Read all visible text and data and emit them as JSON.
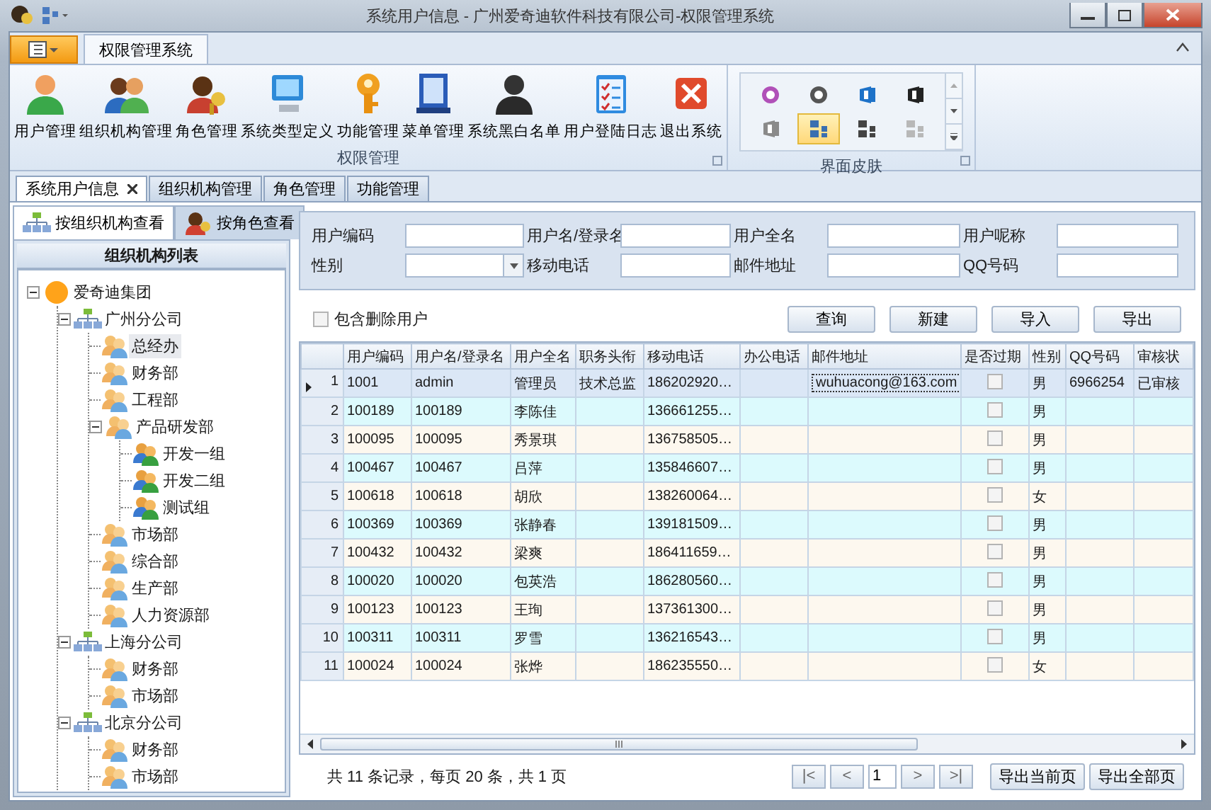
{
  "window": {
    "title": "系统用户信息 - 广州爱奇迪软件科技有限公司-权限管理系统"
  },
  "ribbon": {
    "tabs": [
      {
        "label": "权限管理系统",
        "selected": true
      }
    ],
    "groups": [
      {
        "label": "权限管理",
        "buttons": [
          {
            "label": "用户管理",
            "kind": "person"
          },
          {
            "label": "组织机构管理",
            "kind": "people"
          },
          {
            "label": "角色管理",
            "kind": "role"
          },
          {
            "label": "系统类型定义",
            "kind": "computer"
          },
          {
            "label": "功能管理",
            "kind": "key"
          },
          {
            "label": "菜单管理",
            "kind": "book"
          },
          {
            "label": "系统黑白名单",
            "kind": "silhouette"
          },
          {
            "label": "用户登陆日志",
            "kind": "checklist"
          },
          {
            "label": "退出系统",
            "kind": "exit"
          }
        ]
      }
    ],
    "skins": {
      "label": "界面皮肤",
      "items": [
        {
          "kind": "badge",
          "color": "#b050b8",
          "selected": false
        },
        {
          "kind": "badge",
          "color": "#555555",
          "selected": false
        },
        {
          "kind": "office",
          "color": "#1e72c8",
          "selected": false
        },
        {
          "kind": "office",
          "color": "#222222",
          "selected": false
        },
        {
          "kind": "office",
          "color": "#8a8a8a",
          "selected": false
        },
        {
          "kind": "tiles",
          "color": "#3a6fb0",
          "selected": true
        },
        {
          "kind": "tiles",
          "color": "#444444",
          "selected": false
        },
        {
          "kind": "tiles",
          "color": "#b8b8b8",
          "selected": false
        }
      ]
    }
  },
  "doc_tabs": [
    {
      "label": "系统用户信息",
      "selected": true,
      "closable": true
    },
    {
      "label": "组织机构管理",
      "selected": false,
      "closable": false
    },
    {
      "label": "角色管理",
      "selected": false,
      "closable": false
    },
    {
      "label": "功能管理",
      "selected": false,
      "closable": false
    }
  ],
  "left_panel": {
    "tabs": [
      {
        "label": "按组织机构查看",
        "kind": "org",
        "selected": true
      },
      {
        "label": "按角色查看",
        "kind": "role",
        "selected": false
      }
    ],
    "title": "组织机构列表",
    "tree": [
      {
        "label": "爱奇迪集团",
        "kind": "root",
        "expanded": true,
        "children": [
          {
            "label": "广州分公司",
            "kind": "branch",
            "expanded": true,
            "children": [
              {
                "label": "总经办",
                "kind": "dept",
                "selected": true
              },
              {
                "label": "财务部",
                "kind": "dept",
                "selected": false
              },
              {
                "label": "工程部",
                "kind": "dept",
                "selected": false
              },
              {
                "label": "产品研发部",
                "kind": "dept",
                "expanded": true,
                "selected": false,
                "children": [
                  {
                    "label": "开发一组",
                    "kind": "team",
                    "selected": false
                  },
                  {
                    "label": "开发二组",
                    "kind": "team",
                    "selected": false
                  },
                  {
                    "label": "测试组",
                    "kind": "team",
                    "selected": false
                  }
                ]
              },
              {
                "label": "市场部",
                "kind": "dept",
                "selected": false
              },
              {
                "label": "综合部",
                "kind": "dept",
                "selected": false
              },
              {
                "label": "生产部",
                "kind": "dept",
                "selected": false
              },
              {
                "label": "人力资源部",
                "kind": "dept",
                "selected": false
              }
            ]
          },
          {
            "label": "上海分公司",
            "kind": "branch",
            "expanded": true,
            "children": [
              {
                "label": "财务部",
                "kind": "dept",
                "selected": false
              },
              {
                "label": "市场部",
                "kind": "dept",
                "selected": false
              }
            ]
          },
          {
            "label": "北京分公司",
            "kind": "branch",
            "expanded": true,
            "children": [
              {
                "label": "财务部",
                "kind": "dept",
                "selected": false
              },
              {
                "label": "市场部",
                "kind": "dept",
                "selected": false
              }
            ]
          }
        ]
      }
    ]
  },
  "search_form": {
    "fields": [
      {
        "label": "用户编码",
        "kind": "text"
      },
      {
        "label": "用户名/登录名",
        "kind": "text"
      },
      {
        "label": "用户全名",
        "kind": "text"
      },
      {
        "label": "用户呢称",
        "kind": "text"
      },
      {
        "label": "性别",
        "kind": "select"
      },
      {
        "label": "移动电话",
        "kind": "text"
      },
      {
        "label": "邮件地址",
        "kind": "text"
      },
      {
        "label": "QQ号码",
        "kind": "text"
      }
    ],
    "include_deleted": {
      "label": "包含删除用户",
      "checked": false
    },
    "buttons": [
      "查询",
      "新建",
      "导入",
      "导出"
    ]
  },
  "table": {
    "columns": [
      "用户编码",
      "用户名/登录名",
      "用户全名",
      "职务头衔",
      "移动电话",
      "办公电话",
      "邮件地址",
      "是否过期",
      "性别",
      "QQ号码",
      "审核状"
    ],
    "rows": [
      {
        "number": "1",
        "selected": true,
        "code": "1001",
        "login": "admin",
        "full_name": "管理员",
        "job_title": "技术总监",
        "mobile": "186202920…",
        "email": "wuhuacong@163.com",
        "expired": false,
        "gender": "男",
        "qq": "6966254",
        "status": "已审核"
      },
      {
        "number": "2",
        "selected": false,
        "code": "100189",
        "login": "100189",
        "full_name": "李陈佳",
        "mobile": "136661255…",
        "expired": false,
        "gender": "男"
      },
      {
        "number": "3",
        "selected": false,
        "code": "100095",
        "login": "100095",
        "full_name": "秀景琪",
        "mobile": "136758505…",
        "expired": false,
        "gender": "男"
      },
      {
        "number": "4",
        "selected": false,
        "code": "100467",
        "login": "100467",
        "full_name": "吕萍",
        "mobile": "135846607…",
        "expired": false,
        "gender": "男"
      },
      {
        "number": "5",
        "selected": false,
        "code": "100618",
        "login": "100618",
        "full_name": "胡欣",
        "mobile": "138260064…",
        "expired": false,
        "gender": "女"
      },
      {
        "number": "6",
        "selected": false,
        "code": "100369",
        "login": "100369",
        "full_name": "张静春",
        "mobile": "139181509…",
        "expired": false,
        "gender": "男"
      },
      {
        "number": "7",
        "selected": false,
        "code": "100432",
        "login": "100432",
        "full_name": "梁爽",
        "mobile": "186411659…",
        "expired": false,
        "gender": "男"
      },
      {
        "number": "8",
        "selected": false,
        "code": "100020",
        "login": "100020",
        "full_name": "包英浩",
        "mobile": "186280560…",
        "expired": false,
        "gender": "男"
      },
      {
        "number": "9",
        "selected": false,
        "code": "100123",
        "login": "100123",
        "full_name": "王珣",
        "mobile": "137361300…",
        "expired": false,
        "gender": "男"
      },
      {
        "number": "10",
        "selected": false,
        "code": "100311",
        "login": "100311",
        "full_name": "罗雪",
        "mobile": "136216543…",
        "expired": false,
        "gender": "男"
      },
      {
        "number": "11",
        "selected": false,
        "code": "100024",
        "login": "100024",
        "full_name": "张烨",
        "mobile": "186235550…",
        "expired": false,
        "gender": "女"
      }
    ]
  },
  "pager": {
    "summary": "共 11 条记录，每页 20 条，共 1 页",
    "first": "|<",
    "prev": "<",
    "page": "1",
    "next": ">",
    "last": ">|",
    "buttons": [
      "导出当前页",
      "导出全部页"
    ]
  }
}
